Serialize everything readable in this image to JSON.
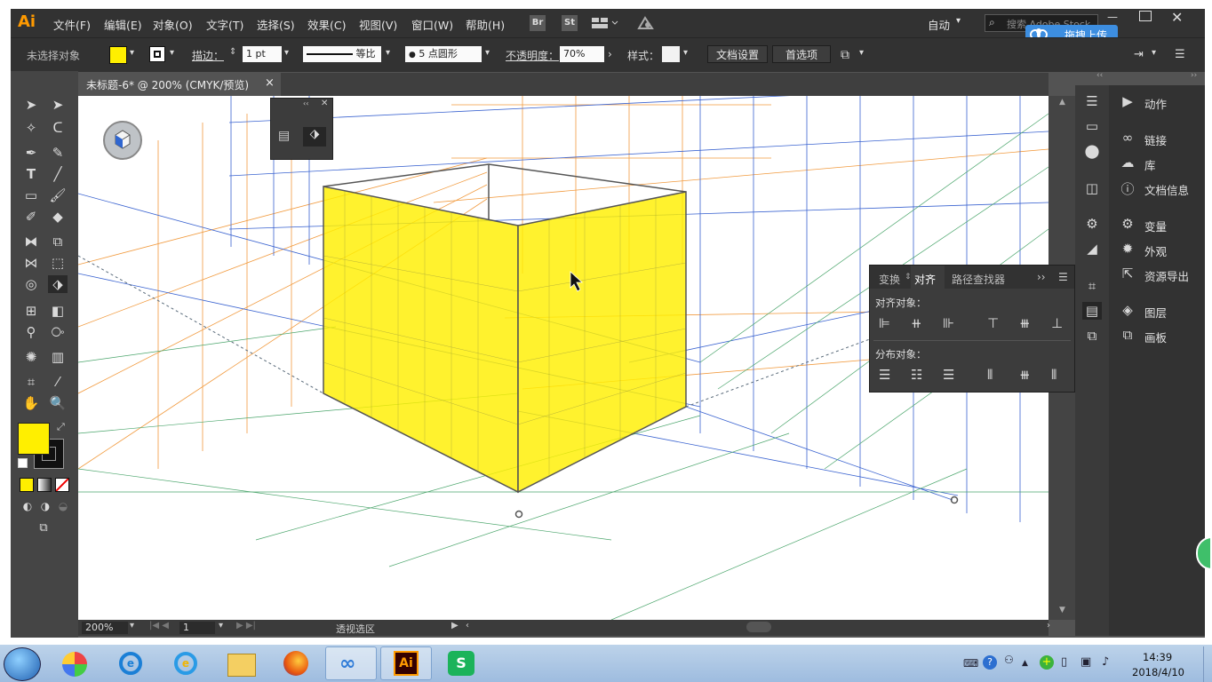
{
  "app": {
    "logo": "Ai"
  },
  "menu": {
    "items": [
      "文件(F)",
      "编辑(E)",
      "对象(O)",
      "文字(T)",
      "选择(S)",
      "效果(C)",
      "视图(V)",
      "窗口(W)",
      "帮助(H)"
    ]
  },
  "menu_right": {
    "bridge": "Br",
    "stock": "St",
    "workspace": "自动",
    "search_placeholder": "搜索 Adobe Stock",
    "upload": "拖拽上传"
  },
  "control": {
    "selection": "未选择对象",
    "stroke_label": "描边：",
    "stroke_value": "1 pt",
    "profile": "等比",
    "brush": "5 点圆形",
    "opacity_label": "不透明度：",
    "opacity_value": "70%",
    "style_label": "样式：",
    "doc_setup": "文档设置",
    "prefs": "首选项"
  },
  "document": {
    "tab": "未标题-6* @ 200% (CMYK/预览)",
    "close": "×"
  },
  "status": {
    "zoom": "200%",
    "page": "1",
    "mode": "透视选区"
  },
  "align_panel": {
    "tabs": [
      "变换",
      "对齐",
      "路径查找器"
    ],
    "align_label": "对齐对象：",
    "distribute_label": "分布对象："
  },
  "right_panels": [
    "动作",
    "链接",
    "库",
    "文档信息",
    "变量",
    "外观",
    "资源导出",
    "图层",
    "画板"
  ],
  "taskbar": {
    "time": "14:39",
    "date": "2018/4/10"
  },
  "colors": {
    "fill": "#ffef00",
    "accent_ai": "#ff9a00",
    "panel_dark": "#323232",
    "grid_blue": "#3a63d0",
    "grid_orange": "#f19a3e",
    "grid_green": "#4aa56b"
  }
}
